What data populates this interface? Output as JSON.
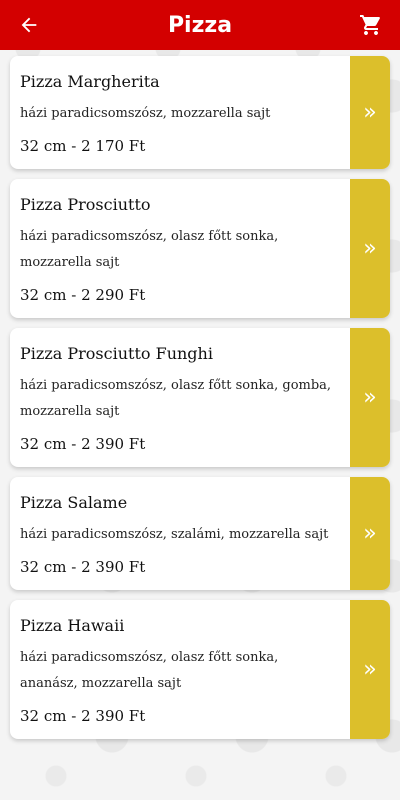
{
  "header": {
    "title": "Pizza",
    "back_icon": "arrow-left-icon",
    "cart_icon": "shopping-cart-icon",
    "bg_color": "#d30000"
  },
  "accent_color": "#dcbf2b",
  "items": [
    {
      "name": "Pizza Margherita",
      "desc": "házi paradicsomszósz, mozzarella sajt",
      "price": "32 cm - 2 170 Ft",
      "arrow": "»"
    },
    {
      "name": "Pizza Prosciutto",
      "desc": "házi paradicsomszósz, olasz főtt sonka, mozzarella sajt",
      "price": "32 cm - 2 290 Ft",
      "arrow": "»"
    },
    {
      "name": "Pizza Prosciutto Funghi",
      "desc": "házi paradicsomszósz, olasz főtt sonka, gomba, mozzarella sajt",
      "price": "32 cm - 2 390 Ft",
      "arrow": "»"
    },
    {
      "name": "Pizza Salame",
      "desc": "házi paradicsomszósz, szalámi, mozzarella sajt",
      "price": "32 cm - 2 390 Ft",
      "arrow": "»"
    },
    {
      "name": "Pizza Hawaii",
      "desc": "házi paradicsomszósz, olasz főtt sonka, ananász, mozzarella sajt",
      "price": "32 cm - 2 390 Ft",
      "arrow": "»"
    }
  ]
}
